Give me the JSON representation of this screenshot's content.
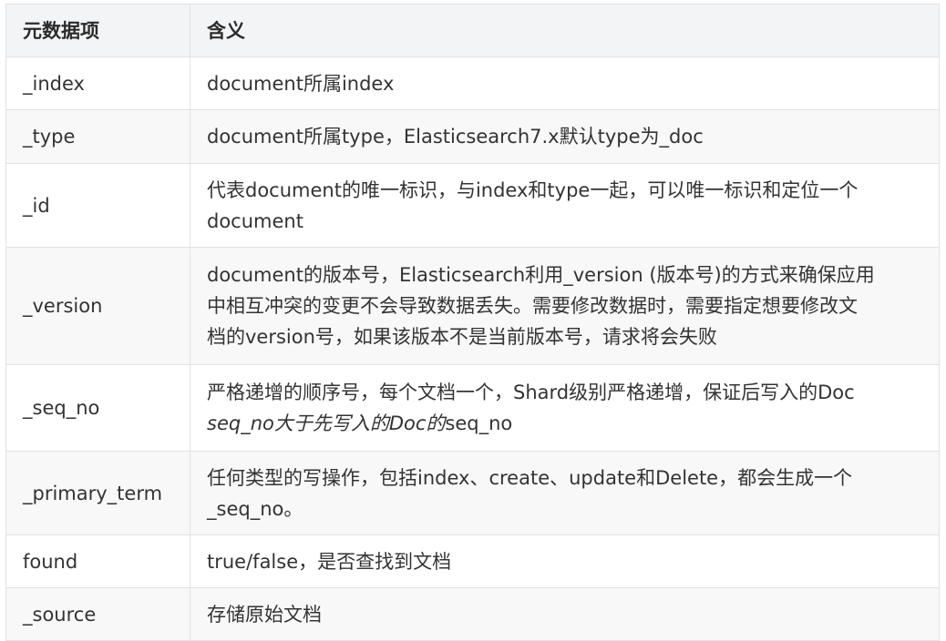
{
  "table": {
    "headers": [
      "元数据项",
      "含义"
    ],
    "rows": [
      {
        "field": "_index",
        "lines": [
          "document所属index"
        ]
      },
      {
        "field": "_type",
        "lines": [
          "document所属type，Elasticsearch7.x默认type为_doc"
        ]
      },
      {
        "field": "_id",
        "lines": [
          "代表document的唯一标识，与index和type一起，可以唯一标识和定位一个",
          "document"
        ]
      },
      {
        "field": "_version",
        "lines": [
          "document的版本号，Elasticsearch利用_version (版本号)的方式来确保应用",
          "中相互冲突的变更不会导致数据丢失。需要修改数据时，需要指定想要修改文",
          "档的version号，如果该版本不是当前版本号，请求将会失败"
        ]
      },
      {
        "field": "_seq_no",
        "lines": [
          "严格递增的顺序号，每个文档一个，Shard级别严格递增，保证后写入的Doc"
        ],
        "italic_part": "seq_no大于先写入的Doc的",
        "tail_part": "seq_no"
      },
      {
        "field": "_primary_term",
        "lines": [
          "任何类型的写操作，包括index、create、update和Delete，都会生成一个",
          "_seq_no。"
        ]
      },
      {
        "field": "found",
        "lines": [
          "true/false，是否查找到文档"
        ]
      },
      {
        "field": "_source",
        "lines": [
          "存储原始文档"
        ]
      }
    ]
  }
}
